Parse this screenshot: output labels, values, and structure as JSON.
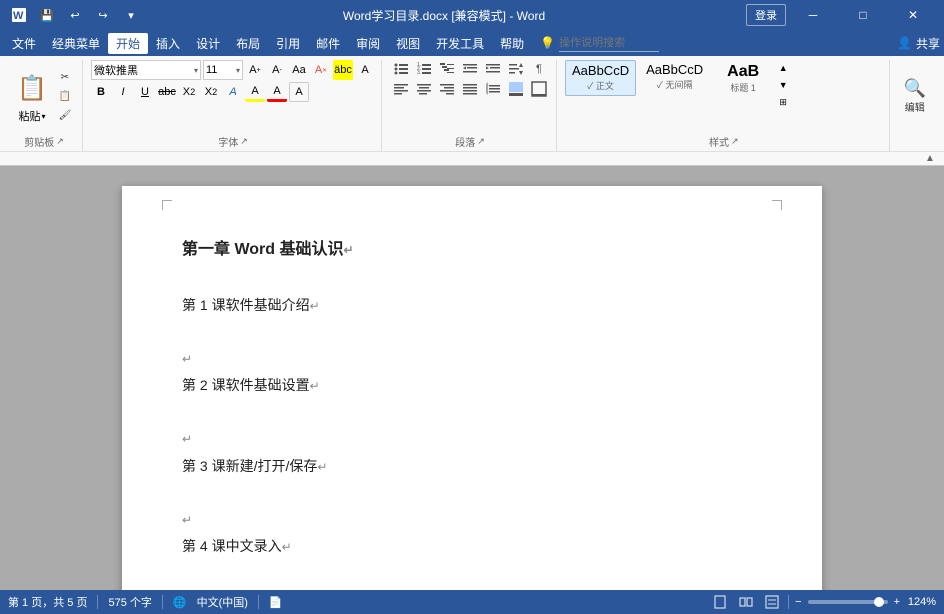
{
  "titlebar": {
    "title": "Word学习目录.docx [兼容模式] - Word",
    "login": "登录",
    "quick_access": [
      "save",
      "undo",
      "redo",
      "customize"
    ]
  },
  "menubar": {
    "items": [
      "文件",
      "经典菜单",
      "开始",
      "插入",
      "设计",
      "布局",
      "引用",
      "邮件",
      "审阅",
      "视图",
      "开发工具",
      "帮助"
    ],
    "active": "开始",
    "help_icon": "💡",
    "search_placeholder": "操作说明搜索",
    "share": "共享"
  },
  "ribbon": {
    "groups": {
      "clipboard": {
        "label": "剪贴板",
        "paste": "粘贴",
        "cut": "✂",
        "copy": "📋",
        "format_painter": "🖌"
      },
      "font": {
        "label": "字体",
        "font_name": "微软推黑",
        "font_size": "11",
        "bold": "B",
        "italic": "I",
        "underline": "U",
        "strikethrough": "abc",
        "subscript": "X₂",
        "superscript": "X²",
        "font_color": "A",
        "highlight": "A"
      },
      "paragraph": {
        "label": "段落",
        "bullets": "≡",
        "numbering": "≡",
        "multilevel": "≡",
        "decrease_indent": "←",
        "increase_indent": "→",
        "sort": "↕",
        "show_marks": "¶",
        "align_left": "≡",
        "align_center": "≡",
        "align_right": "≡",
        "justify": "≡",
        "line_spacing": "↕",
        "shading": "▦",
        "border": "□"
      },
      "styles": {
        "label": "样式",
        "items": [
          {
            "name": "正文",
            "preview": "AaBbCcD",
            "active": true
          },
          {
            "name": "无间隔",
            "preview": "AaBbCcD",
            "active": false
          },
          {
            "name": "标题 1",
            "preview": "AaB",
            "active": false,
            "bold": true
          }
        ]
      },
      "editing": {
        "label": "编辑",
        "button": "编辑"
      }
    }
  },
  "document": {
    "lines": [
      {
        "text": "第一章 Word 基础认识",
        "type": "heading1",
        "mark": "↵"
      },
      {
        "text": "",
        "type": "empty"
      },
      {
        "text": "第 1 课软件基础介绍",
        "type": "heading2",
        "mark": "↵",
        "wavy": true
      },
      {
        "text": "",
        "type": "empty"
      },
      {
        "text": "↵",
        "type": "empty-mark"
      },
      {
        "text": "第 2 课软件基础设置",
        "type": "heading2",
        "mark": "↵",
        "wavy": true
      },
      {
        "text": "",
        "type": "empty"
      },
      {
        "text": "↵",
        "type": "empty-mark"
      },
      {
        "text": "第 3 课新建/打开/保存",
        "type": "heading2",
        "mark": "↵"
      },
      {
        "text": "",
        "type": "empty"
      },
      {
        "text": "↵",
        "type": "empty-mark"
      },
      {
        "text": "第 4 课中文录入",
        "type": "heading2",
        "mark": "↵"
      }
    ]
  },
  "statusbar": {
    "page_info": "第 1 页，共 5 页",
    "word_count": "575 个字",
    "lang_icon": "🌐",
    "language": "中文(中国)",
    "doc_status": "📄",
    "zoom": "124%",
    "zoom_minus": "−",
    "zoom_plus": "+"
  }
}
